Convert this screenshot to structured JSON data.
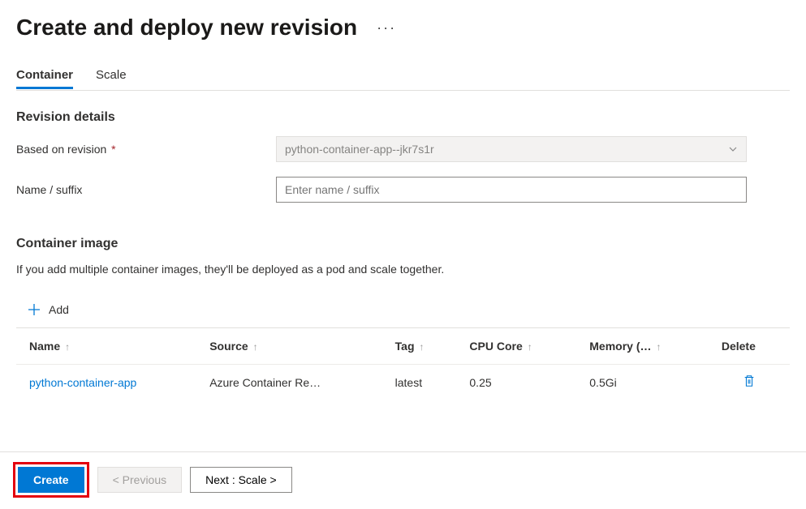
{
  "header": {
    "title": "Create and deploy new revision",
    "more": "···"
  },
  "tabs": [
    {
      "label": "Container",
      "active": true
    },
    {
      "label": "Scale",
      "active": false
    }
  ],
  "revision": {
    "heading": "Revision details",
    "basedOnLabel": "Based on revision",
    "basedOnValue": "python-container-app--jkr7s1r",
    "nameLabel": "Name / suffix",
    "namePlaceholder": "Enter name / suffix",
    "nameValue": ""
  },
  "containerImage": {
    "heading": "Container image",
    "description": "If you add multiple container images, they'll be deployed as a pod and scale together.",
    "addLabel": "Add",
    "columns": {
      "name": "Name",
      "source": "Source",
      "tag": "Tag",
      "cpu": "CPU Core",
      "memory": "Memory (…",
      "delete": "Delete"
    },
    "rows": [
      {
        "name": "python-container-app",
        "source": "Azure Container Re…",
        "tag": "latest",
        "cpu": "0.25",
        "memory": "0.5Gi"
      }
    ]
  },
  "footer": {
    "create": "Create",
    "previous": "< Previous",
    "next": "Next : Scale >"
  },
  "colors": {
    "primary": "#0078d4",
    "highlight": "#e3000f"
  }
}
